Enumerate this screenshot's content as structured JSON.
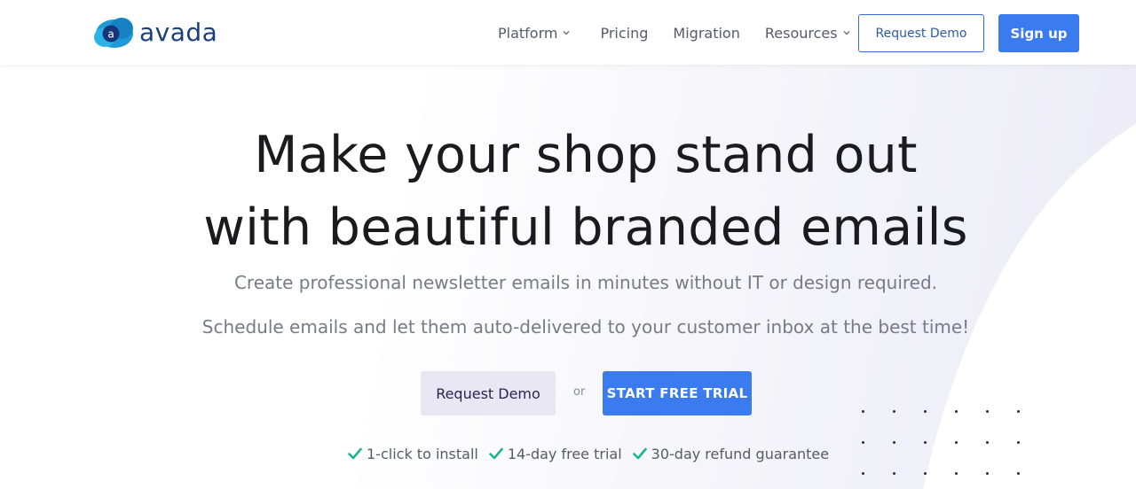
{
  "brand": {
    "name": "avada",
    "mark_letter": "a",
    "primary_color": "#3a7bf0",
    "logo_text_color": "#1c3f7a"
  },
  "nav": {
    "items": [
      {
        "label": "Platform",
        "has_dropdown": true
      },
      {
        "label": "Pricing",
        "has_dropdown": false
      },
      {
        "label": "Migration",
        "has_dropdown": false
      },
      {
        "label": "Resources",
        "has_dropdown": true
      }
    ],
    "request_demo_label": "Request Demo",
    "signup_label": "Sign up"
  },
  "hero": {
    "title_line1": "Make your shop stand out",
    "title_line2": "with beautiful branded emails",
    "subtitle1": "Create professional newsletter emails in minutes without IT or design required.",
    "subtitle2": "Schedule emails and let them auto-delivered to your customer inbox at the best time!",
    "cta_demo_label": "Request Demo",
    "cta_or": "or",
    "cta_trial_label": "START FREE TRIAL",
    "features": [
      "1-click to install",
      "14-day free trial",
      "30-day refund guarantee"
    ],
    "check_color": "#1ab394"
  }
}
